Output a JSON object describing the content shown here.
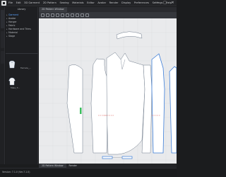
{
  "menubar": {
    "items": [
      "File",
      "Edit",
      "3D Garment",
      "2D Pattern",
      "Sewing",
      "Materials",
      "Editor",
      "Avatar",
      "Render",
      "Display",
      "Preferences",
      "Settings",
      "Help"
    ]
  },
  "window_controls": {
    "minimize": "–",
    "maximize": "□",
    "close": "✕"
  },
  "library": {
    "title": "Library",
    "tree": [
      {
        "label": "Garment",
        "selected": true
      },
      {
        "label": "Avatar",
        "selected": false
      },
      {
        "label": "Hanger",
        "selected": false
      },
      {
        "label": "Fabric",
        "selected": false
      },
      {
        "label": "Hardware and Trims",
        "selected": false
      },
      {
        "label": "Material",
        "selected": false
      },
      {
        "label": "Stage",
        "selected": false
      }
    ],
    "items": [
      {
        "label": "Female_..."
      },
      {
        "label": "Male_T..."
      }
    ]
  },
  "pattern_window": {
    "tab": "2D Pattern Window"
  },
  "bottom_tabs": [
    "2D Pattern Window",
    "Render"
  ],
  "status": {
    "text": "Version: 7.1.0 (Ver.7.1.0)"
  },
  "colors": {
    "ui_bg": "#1b1c1e",
    "canvas_bg": "#e9eaec",
    "pattern_fill": "#ffffff",
    "pattern_outline": "#6e7a8a",
    "selection_blue": "#3b7dd8",
    "seam_red": "#d9534f",
    "accent_green": "#3bbf5e"
  }
}
